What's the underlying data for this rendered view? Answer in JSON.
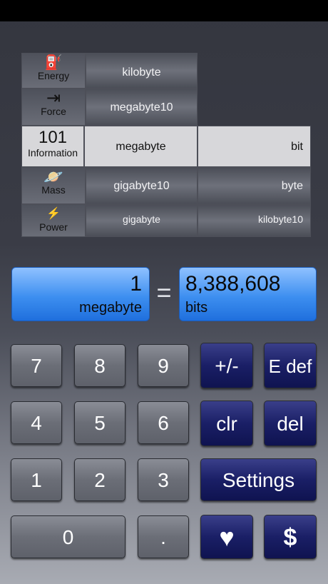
{
  "picker": {
    "categories": [
      {
        "label": "Energy",
        "icon": "⛽"
      },
      {
        "label": "Force",
        "icon": "⇥"
      },
      {
        "label": "Information",
        "value": "101"
      },
      {
        "label": "Mass",
        "icon": "🪐"
      },
      {
        "label": "Power",
        "icon": "⚡"
      }
    ],
    "from_units": [
      "kilobyte",
      "megabyte10",
      "megabyte",
      "gigabyte10",
      "gigabyte"
    ],
    "to_units": [
      "bit",
      "byte",
      "kilobyte10"
    ]
  },
  "display": {
    "input_value": "1",
    "input_unit": "megabyte",
    "equals": "=",
    "output_value": "8,388,608",
    "output_unit": "bits"
  },
  "keys": {
    "k7": "7",
    "k8": "8",
    "k9": "9",
    "plusminus": "+/-",
    "edef": "E def",
    "k4": "4",
    "k5": "5",
    "k6": "6",
    "clr": "clr",
    "del": "del",
    "k1": "1",
    "k2": "2",
    "k3": "3",
    "settings": "Settings",
    "k0": "0",
    "dot": ".",
    "heart": "♥",
    "dollar": "$"
  },
  "colors": {
    "display_blue": "#3d8ff0",
    "key_navy": "#1a1f66",
    "key_gray": "#6b6e77"
  }
}
